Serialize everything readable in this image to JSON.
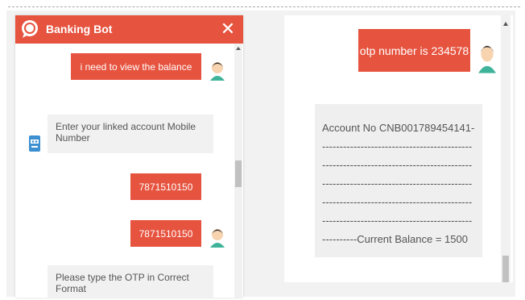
{
  "chat": {
    "title": "Banking Bot",
    "close_glyph": "✕",
    "logo_icon": "chat-bubble-icon",
    "user_avatar_icon": "user-avatar-icon",
    "bot_avatar_icon": "bot-robot-icon",
    "messages": [
      {
        "from": "user",
        "text": "i need to view the balance"
      },
      {
        "from": "bot",
        "text": "Enter your linked account Mobile Number"
      },
      {
        "from": "user",
        "text": "7871510150"
      },
      {
        "from": "user",
        "text": "7871510150"
      },
      {
        "from": "bot",
        "text": "Please type the OTP  in  Correct Format"
      }
    ]
  },
  "right": {
    "otp_message": "otp number is 234578",
    "balance_lines": [
      "Account No CNB001789454141---",
      "-------------------------------------------",
      "-------------------------------------------",
      "-------------------------------------------",
      "-------------------------------------------",
      "-------------------------------------------",
      "----------Current Balance = 1500"
    ]
  },
  "colors": {
    "accent": "#e6533f",
    "bot_bubble": "#f1f1f1",
    "panel_bg": "#f2f2f2"
  }
}
